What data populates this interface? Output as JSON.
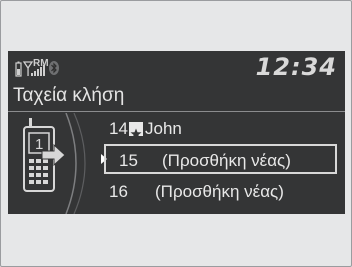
{
  "status": {
    "network": "RM",
    "clock": "12:34",
    "icons": [
      "battery-icon",
      "signal-icon",
      "bluetooth-icon"
    ]
  },
  "screen_title": "Ταχεία κλήση",
  "speed_dial": {
    "items": [
      {
        "number": "14",
        "label": "John",
        "has_voice_tag": true,
        "selected": false
      },
      {
        "number": "15",
        "label": "(Προσθήκη νέας)",
        "selected": true
      },
      {
        "number": "16",
        "label": "(Προσθήκη νέας)",
        "selected": false
      }
    ]
  },
  "colors": {
    "screen_bg": "#343536",
    "text": "#e8e8e8",
    "frame_bg": "#e6e7e8"
  }
}
